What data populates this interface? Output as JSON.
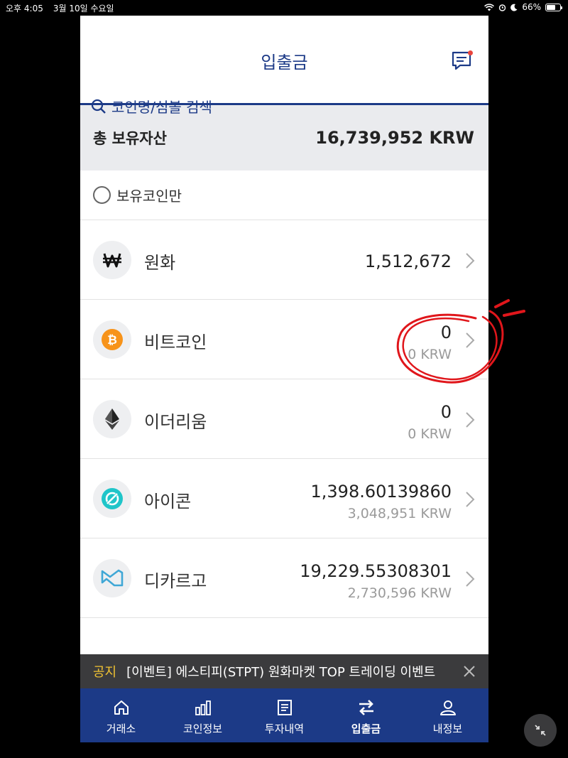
{
  "status_bar": {
    "time": "오후 4:05",
    "date": "3월 10일 수요일",
    "battery": "66%",
    "battery_level": 0.66
  },
  "header": {
    "title": "입출금",
    "search_placeholder": "코인명/심볼 검색"
  },
  "total": {
    "label": "총 보유자산",
    "value": "16,739,952 KRW"
  },
  "filter": {
    "label": "보유코인만"
  },
  "coins": [
    {
      "name": "원화",
      "amount": "1,512,672",
      "krw": "",
      "icon": "won-icon"
    },
    {
      "name": "비트코인",
      "amount": "0",
      "krw": "0 KRW",
      "icon": "bitcoin-icon"
    },
    {
      "name": "이더리움",
      "amount": "0",
      "krw": "0 KRW",
      "icon": "ethereum-icon"
    },
    {
      "name": "아이콘",
      "amount": "1,398.60139860",
      "krw": "3,048,951 KRW",
      "icon": "icx-icon"
    },
    {
      "name": "디카르고",
      "amount": "19,229.55308301",
      "krw": "2,730,596 KRW",
      "icon": "dkargo-icon"
    }
  ],
  "notice": {
    "tag": "공지",
    "text": "[이벤트] 에스티피(STPT) 원화마켓 TOP 트레이딩 이벤트"
  },
  "tabs": [
    {
      "label": "거래소",
      "icon": "home-icon"
    },
    {
      "label": "코인정보",
      "icon": "bar-chart-icon"
    },
    {
      "label": "투자내역",
      "icon": "document-icon"
    },
    {
      "label": "입출금",
      "icon": "transfer-icon"
    },
    {
      "label": "내정보",
      "icon": "user-icon"
    }
  ],
  "colors": {
    "brand": "#1c3a87",
    "notice_tag": "#f0c232",
    "bitcoin": "#f7931a",
    "icx": "#1fc5c9",
    "dkargo": "#3fa7d6",
    "annotation": "#e0161b"
  }
}
